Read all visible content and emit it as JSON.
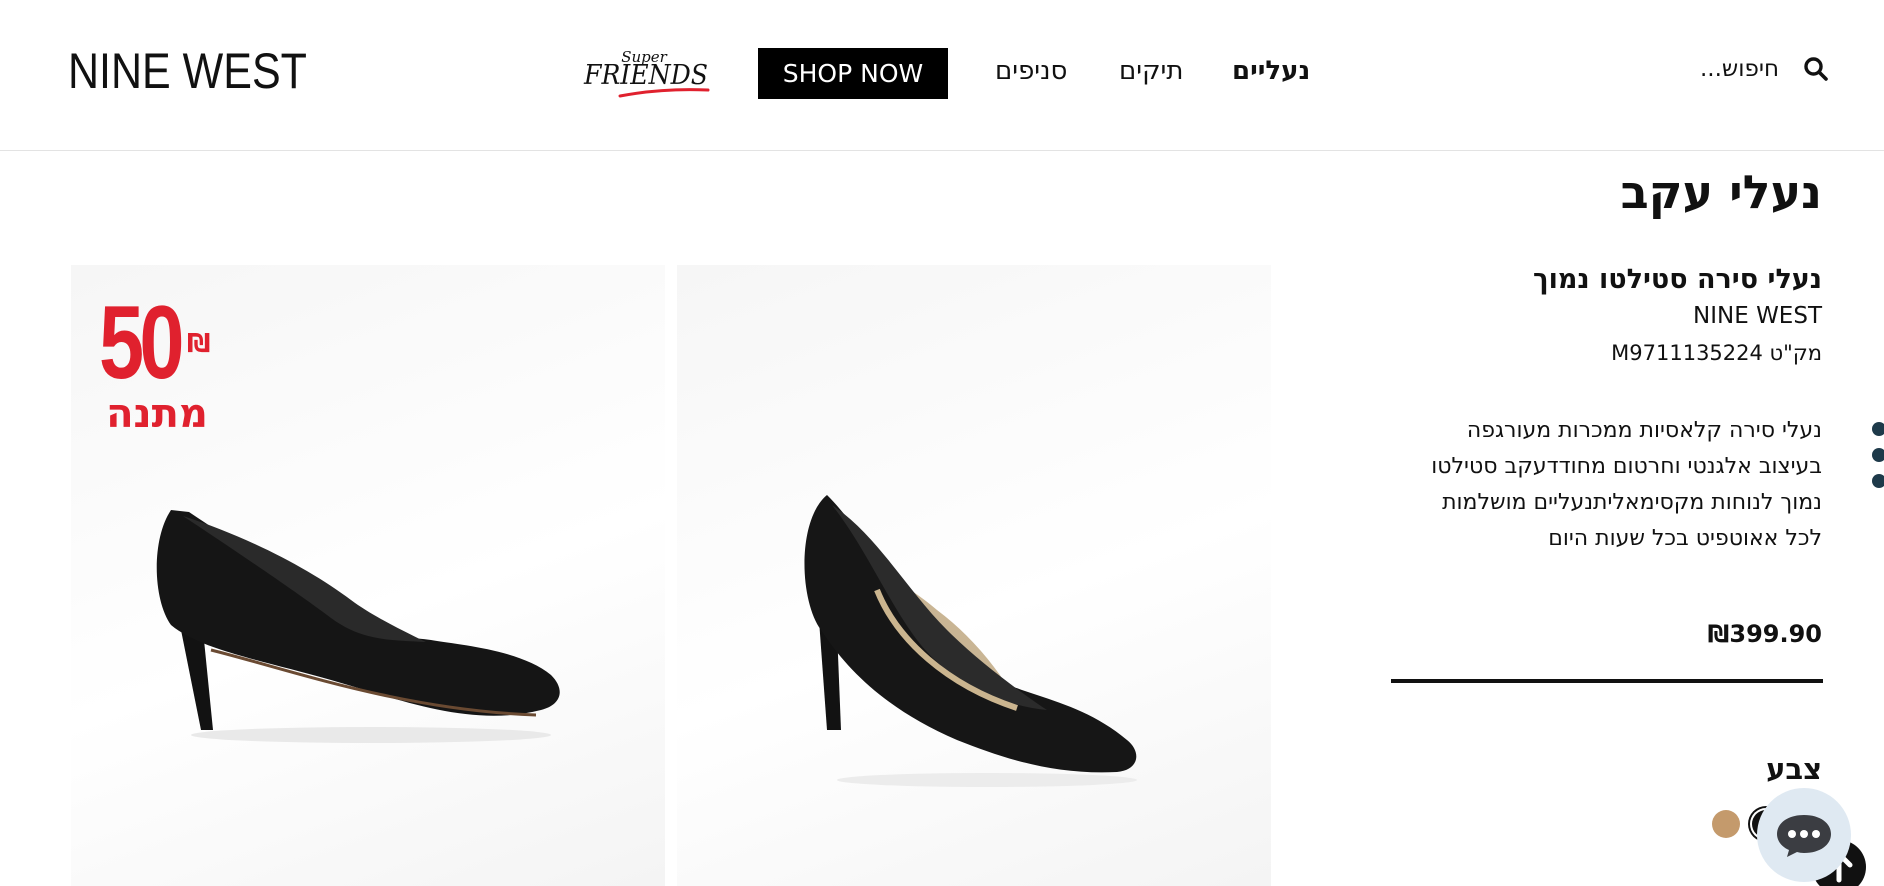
{
  "header": {
    "logo": "NINE WEST",
    "super_friends_top": "Super",
    "super_friends_main": "FRIENDS",
    "shop_now": "SHOP NOW",
    "nav": {
      "stores": "סניפים",
      "bags": "תיקים",
      "shoes": "נעליים"
    },
    "search_placeholder": "חיפוש..."
  },
  "images": {
    "badge_number": "50",
    "badge_currency": "₪",
    "badge_text": "מתנה"
  },
  "product": {
    "category_title": "נעלי עקב",
    "name": "נעלי סירה סטילטו נמוך",
    "brand": "NINE WEST",
    "sku": "מק\"ט M9711135224",
    "description_lines": [
      "נעלי סירה קלאסיות ממכרות מעורגפה",
      "בעיצוב אלגנטי וחרטום מחודדעקב סטילטו",
      "נמוך לנוחות מקסימאליתנעליים מושלמות",
      "לכל אאוטפיט בכל שעות היום"
    ],
    "price": "₪399.90",
    "color_label": "צבע",
    "colors": [
      "#c49a6c",
      "#111111"
    ]
  },
  "icons": {
    "search": "search-icon",
    "chat": "chat-icon",
    "back_to_top": "arrow-up-icon"
  }
}
